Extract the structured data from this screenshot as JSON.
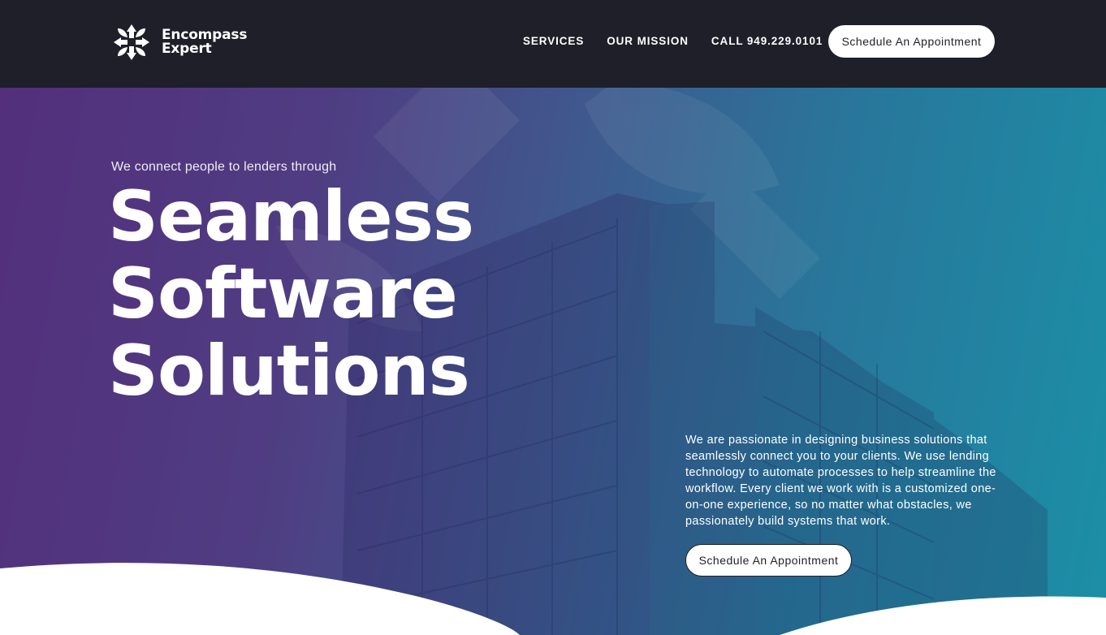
{
  "brand": {
    "line1": "Encompass",
    "line2": "Expert"
  },
  "nav": {
    "items": [
      "SERVICES",
      "OUR MISSION",
      "CALL 949.229.0101"
    ],
    "cta_label": "Schedule An Appointment"
  },
  "hero": {
    "eyebrow": "We connect people to lenders through",
    "headline": [
      "Seamless",
      "Software",
      "Solutions"
    ],
    "description": "We are passionate in designing business solutions that seamlessly connect you to your clients. We use lending technology to automate processes to help streamline the workflow. Every client we work with is a customized one-on-one experience, so no matter what obstacles, we passionately build systems that work.",
    "cta_label": "Schedule An Appointment"
  },
  "colors": {
    "navbar": "#1e1f29",
    "gradient_start": "#532f7c",
    "gradient_end": "#1b8fa6",
    "button_bg": "#ffffff",
    "button_text": "#1e1f29"
  },
  "icons": {
    "logo": "encompass-logo-icon"
  }
}
